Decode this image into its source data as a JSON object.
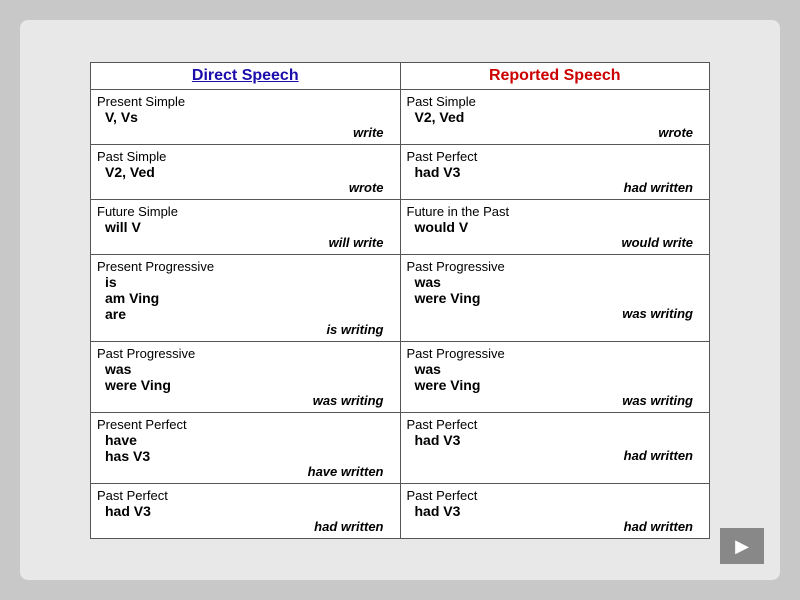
{
  "headers": {
    "direct": "Direct Speech",
    "reported": "Reported Speech"
  },
  "rows": [
    {
      "direct_label": "Present Simple",
      "direct_forms": "V, Vs",
      "direct_example": "write",
      "reported_label": "Past Simple",
      "reported_forms": "V2, Ved",
      "reported_example": "wrote"
    },
    {
      "direct_label": "Past Simple",
      "direct_forms": "V2, Ved",
      "direct_example": "wrote",
      "reported_label": "Past Perfect",
      "reported_forms": "had V3",
      "reported_example": "had written"
    },
    {
      "direct_label": "Future Simple",
      "direct_forms": "will V",
      "direct_example": "will write",
      "reported_label": "Future in the Past",
      "reported_forms": "would V",
      "reported_example": "would write"
    },
    {
      "direct_label": "Present Progressive",
      "direct_forms_multi": [
        "is",
        "am  Ving",
        "are"
      ],
      "direct_example": "is writing",
      "reported_label": "Past Progressive",
      "reported_forms_multi": [
        "was",
        "were  Ving"
      ],
      "reported_example": "was writing"
    },
    {
      "direct_label": "Past Progressive",
      "direct_forms_multi": [
        "was",
        "were  Ving"
      ],
      "direct_example": "was writing",
      "reported_label": "Past Progressive",
      "reported_forms_multi": [
        "was",
        "were  Ving"
      ],
      "reported_example": "was writing"
    },
    {
      "direct_label": "Present Perfect",
      "direct_forms_multi": [
        "have",
        "has   V3"
      ],
      "direct_example": "have written",
      "reported_label": "Past Perfect",
      "reported_forms": "had  V3",
      "reported_example": "had written"
    },
    {
      "direct_label": "Past Perfect",
      "direct_forms": "had  V3",
      "direct_example": "had written",
      "reported_label": "Past Perfect",
      "reported_forms": "had  V3",
      "reported_example": "had written"
    }
  ],
  "nav_button_label": "▶"
}
